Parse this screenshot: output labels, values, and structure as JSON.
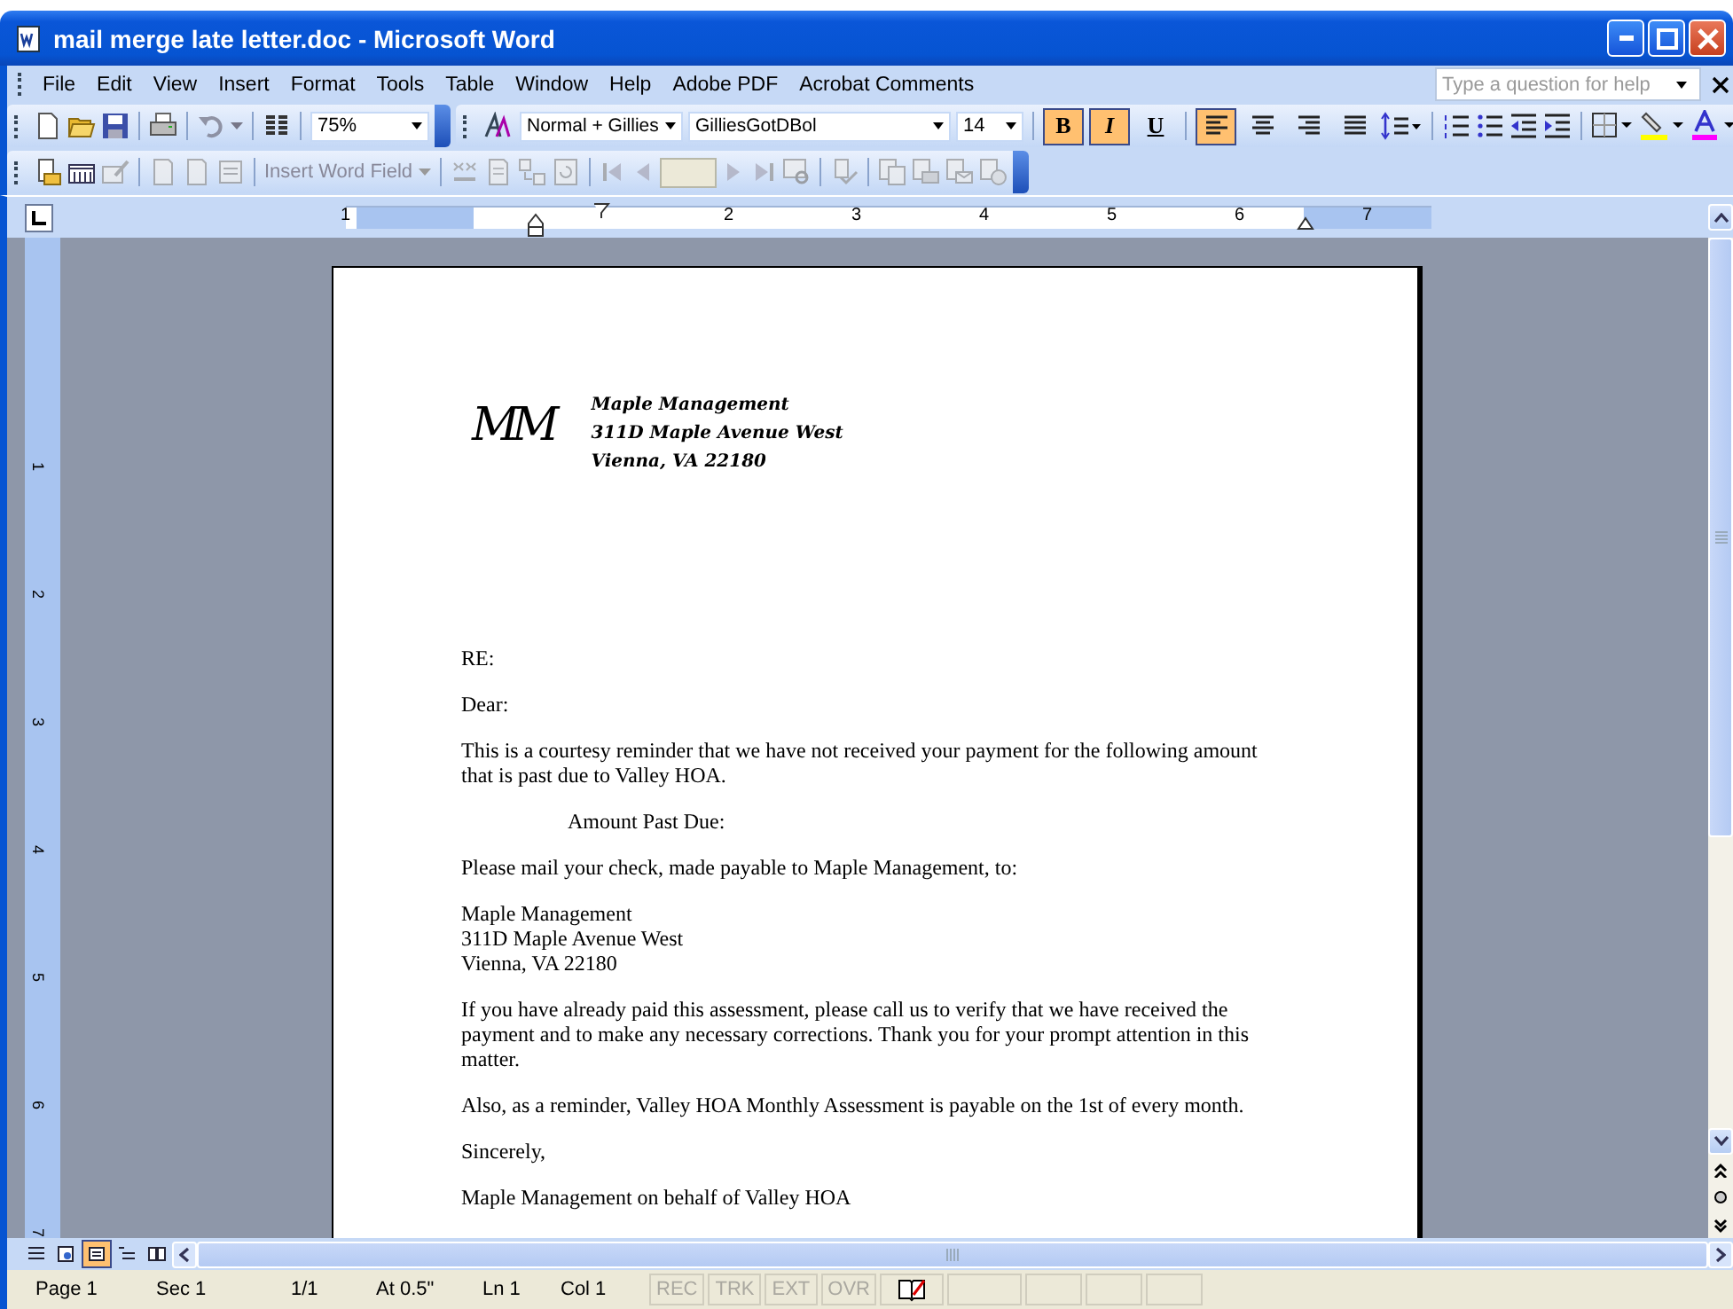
{
  "window": {
    "title": "mail merge late letter.doc - Microsoft Word"
  },
  "menu": [
    "File",
    "Edit",
    "View",
    "Insert",
    "Format",
    "Tools",
    "Table",
    "Window",
    "Help",
    "Adobe PDF",
    "Acrobat Comments"
  ],
  "help_box": {
    "placeholder": "Type a question for help"
  },
  "standard_toolbar": {
    "zoom": "75%"
  },
  "formatting_toolbar": {
    "style": "Normal + Gillies",
    "font": "GilliesGotDBol",
    "size": "14",
    "toggles": [
      {
        "label": "B",
        "kind": "bold",
        "selected": true
      },
      {
        "label": "I",
        "kind": "italic",
        "selected": true
      },
      {
        "label": "U",
        "kind": "underline",
        "selected": false
      }
    ],
    "alignment": [
      {
        "kind": "left",
        "selected": true
      },
      {
        "kind": "center",
        "selected": false
      },
      {
        "kind": "right",
        "selected": false
      },
      {
        "kind": "justify",
        "selected": false
      }
    ]
  },
  "mail_merge_toolbar": {
    "insert_field": "Insert Word Field"
  },
  "ruler": {
    "numbers": [
      "1",
      "2",
      "3",
      "4",
      "5",
      "6",
      "7"
    ]
  },
  "vertical_ruler": {
    "numbers": [
      "1",
      "2",
      "3",
      "4",
      "5",
      "6",
      "7"
    ]
  },
  "document": {
    "logo": "MM",
    "letterhead": [
      "Maple Management",
      "311D Maple Avenue West",
      "Vienna, VA 22180"
    ],
    "paragraphs": [
      {
        "kind": "plain",
        "lines": [
          "RE:"
        ]
      },
      {
        "kind": "plain",
        "lines": [
          "Dear:"
        ]
      },
      {
        "kind": "plain",
        "lines": [
          "This is a courtesy reminder that we have not received your payment for the following amount",
          "that is past due to Valley HOA."
        ]
      },
      {
        "kind": "indented",
        "lines": [
          "Amount Past Due:"
        ]
      },
      {
        "kind": "plain",
        "lines": [
          "Please mail your check, made payable to Maple Management, to:"
        ]
      },
      {
        "kind": "plain",
        "lines": [
          "Maple Management",
          "311D Maple Avenue West",
          "Vienna, VA 22180"
        ]
      },
      {
        "kind": "plain",
        "lines": [
          "If you have already paid this assessment, please call us to verify that we have received the",
          "payment and to make any necessary corrections.  Thank you for your prompt attention in this",
          "matter."
        ]
      },
      {
        "kind": "plain",
        "lines": [
          "Also, as a reminder, Valley HOA Monthly Assessment is payable on the 1st of every month."
        ]
      },
      {
        "kind": "plain",
        "lines": [
          "Sincerely,"
        ]
      },
      {
        "kind": "plain",
        "lines": [
          "Maple Management on behalf of Valley HOA"
        ]
      }
    ]
  },
  "view_buttons": [
    {
      "kind": "normal",
      "selected": false
    },
    {
      "kind": "web",
      "selected": false
    },
    {
      "kind": "print",
      "selected": true
    },
    {
      "kind": "outline",
      "selected": false
    },
    {
      "kind": "reading",
      "selected": false
    }
  ],
  "status_bar": {
    "fields": [
      "Page 1",
      "Sec 1",
      "1/1",
      "At 0.5\"",
      "Ln 1",
      "Col 1"
    ],
    "modes": [
      {
        "label": "REC",
        "disabled": true
      },
      {
        "label": "TRK",
        "disabled": true
      },
      {
        "label": "EXT",
        "disabled": true
      },
      {
        "label": "OVR",
        "disabled": true
      }
    ]
  }
}
